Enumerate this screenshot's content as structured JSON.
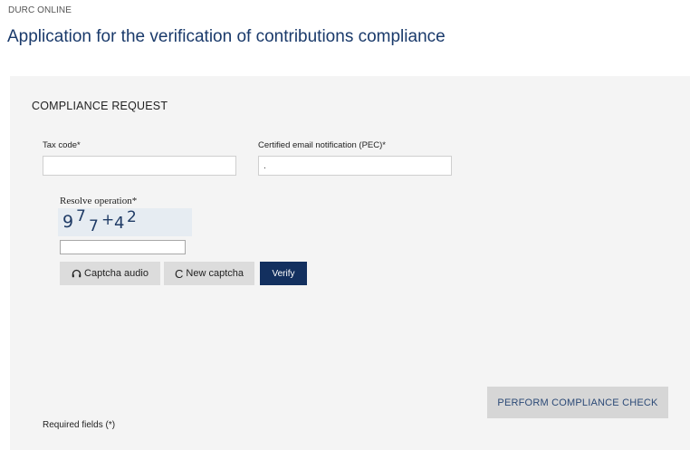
{
  "header": {
    "breadcrumb": "DURC ONLINE",
    "title": "Application for the verification of contributions compliance"
  },
  "form": {
    "section_title": "COMPLIANCE REQUEST",
    "tax_code": {
      "label": "Tax code*",
      "value": ""
    },
    "pec": {
      "label": "Certified email notification (PEC)*",
      "value": "."
    },
    "captcha": {
      "label": "Resolve operation*",
      "glyphs": [
        "9",
        "7",
        "7",
        "+",
        "4",
        "2"
      ],
      "input_value": ""
    },
    "buttons": {
      "audio": "Captcha audio",
      "new_captcha": "New captcha",
      "verify": "Verify"
    },
    "perform_button": "PERFORM COMPLIANCE CHECK",
    "required_note": "Required fields (*)"
  },
  "icons": {
    "audio": "headphones-icon",
    "new_captcha": "refresh-icon"
  },
  "colors": {
    "title": "#1a3a6b",
    "primary_button": "#13305f",
    "panel_background": "#f4f4f4",
    "grey_button": "#dcdcdc"
  }
}
